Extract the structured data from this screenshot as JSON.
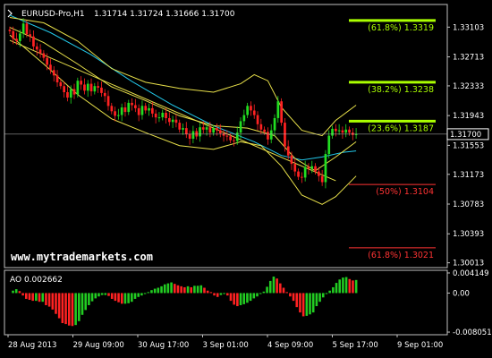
{
  "chart_data": [
    {
      "type": "candlestick",
      "title": "EURUSD-Pro,H1",
      "ohlc_header": "1.31714 1.31724 1.31666 1.31700",
      "current_price": 1.317,
      "ylim": [
        1.2995,
        1.334
      ],
      "y_ticks": [
        "1.33103",
        "1.32713",
        "1.32333",
        "1.31943",
        "1.31553",
        "1.31173",
        "1.30783",
        "1.30393",
        "1.30013"
      ],
      "y_tick_values": [
        1.33103,
        1.32713,
        1.32333,
        1.31943,
        1.31553,
        1.31173,
        1.30783,
        1.30393,
        1.30013
      ],
      "price_label": "1.31700",
      "x_tick_labels": [
        "28 Aug 2013",
        "29 Aug 09:00",
        "30 Aug 17:00",
        "3 Sep 01:00",
        "4 Sep 09:00",
        "5 Sep 17:00",
        "9 Sep 01:00"
      ],
      "close_path": [
        1.3305,
        1.3295,
        1.3292,
        1.3302,
        1.3315,
        1.3301,
        1.3298,
        1.3285,
        1.3281,
        1.3276,
        1.327,
        1.3261,
        1.3254,
        1.3247,
        1.3238,
        1.3233,
        1.3225,
        1.3218,
        1.3229,
        1.3222,
        1.324,
        1.3235,
        1.3227,
        1.3236,
        1.3226,
        1.3233,
        1.3231,
        1.3224,
        1.322,
        1.3207,
        1.32,
        1.3194,
        1.3195,
        1.3205,
        1.3199,
        1.3211,
        1.3208,
        1.3204,
        1.3195,
        1.3207,
        1.3201,
        1.3204,
        1.3197,
        1.3192,
        1.3192,
        1.3198,
        1.3191,
        1.3186,
        1.3189,
        1.3185,
        1.3176,
        1.3178,
        1.317,
        1.3164,
        1.3174,
        1.3167,
        1.3179,
        1.3176,
        1.3179,
        1.3172,
        1.3178,
        1.3175,
        1.3171,
        1.3168,
        1.3167,
        1.3162,
        1.3161,
        1.3172,
        1.3187,
        1.3195,
        1.3207,
        1.3201,
        1.3195,
        1.3183,
        1.3176,
        1.3173,
        1.3163,
        1.3175,
        1.3191,
        1.3213,
        1.3185,
        1.3154,
        1.3142,
        1.3131,
        1.3121,
        1.3114,
        1.3113,
        1.3127,
        1.3125,
        1.3128,
        1.3121,
        1.3115,
        1.3107,
        1.3144,
        1.3168,
        1.3177,
        1.3174,
        1.3175,
        1.3172,
        1.3176,
        1.3172,
        1.3169,
        1.317
      ],
      "indicators": {
        "bollinger_upper": [
          [
            0,
            1.3323
          ],
          [
            10,
            1.3316
          ],
          [
            20,
            1.3292
          ],
          [
            30,
            1.3256
          ],
          [
            40,
            1.3238
          ],
          [
            50,
            1.323
          ],
          [
            60,
            1.3225
          ],
          [
            68,
            1.3236
          ],
          [
            72,
            1.3248
          ],
          [
            76,
            1.324
          ],
          [
            80,
            1.3205
          ],
          [
            86,
            1.3175
          ],
          [
            92,
            1.3168
          ],
          [
            96,
            1.3188
          ],
          [
            102,
            1.3208
          ]
        ],
        "bollinger_lower": [
          [
            0,
            1.33
          ],
          [
            10,
            1.3262
          ],
          [
            20,
            1.3222
          ],
          [
            30,
            1.319
          ],
          [
            40,
            1.3172
          ],
          [
            50,
            1.3155
          ],
          [
            60,
            1.315
          ],
          [
            68,
            1.316
          ],
          [
            74,
            1.3155
          ],
          [
            80,
            1.3128
          ],
          [
            86,
            1.309
          ],
          [
            92,
            1.3078
          ],
          [
            96,
            1.3088
          ],
          [
            102,
            1.3115
          ]
        ],
        "bollinger_middle": [
          [
            0,
            1.331
          ],
          [
            10,
            1.329
          ],
          [
            20,
            1.3262
          ],
          [
            30,
            1.3232
          ],
          [
            40,
            1.3214
          ],
          [
            50,
            1.3194
          ],
          [
            60,
            1.3181
          ],
          [
            70,
            1.3178
          ],
          [
            78,
            1.3168
          ],
          [
            84,
            1.3138
          ],
          [
            90,
            1.3122
          ],
          [
            96,
            1.314
          ],
          [
            102,
            1.316
          ]
        ],
        "moving_average": [
          [
            0,
            1.3326
          ],
          [
            12,
            1.3303
          ],
          [
            24,
            1.3274
          ],
          [
            36,
            1.3239
          ],
          [
            48,
            1.3208
          ],
          [
            60,
            1.3181
          ],
          [
            72,
            1.316
          ],
          [
            80,
            1.3142
          ],
          [
            86,
            1.3136
          ],
          [
            92,
            1.314
          ],
          [
            98,
            1.3146
          ],
          [
            102,
            1.3148
          ]
        ],
        "trendline": [
          [
            0,
            1.3293
          ],
          [
            96,
            1.3109
          ]
        ]
      },
      "fibonacci": [
        {
          "label": "(61.8%) 1.3319",
          "value": 1.3319,
          "color": "#aaff00"
        },
        {
          "label": "(38.2%) 1.3238",
          "value": 1.3238,
          "color": "#aaff00"
        },
        {
          "label": "(23.6%) 1.3187",
          "value": 1.3187,
          "color": "#aaff00"
        },
        {
          "label": "(50%) 1.3104",
          "value": 1.3104,
          "color": "#ff3333"
        },
        {
          "label": "(61.8%) 1.3021",
          "value": 1.3021,
          "color": "#ff3333"
        }
      ],
      "watermark": "www.mytrademarkets.com"
    },
    {
      "type": "histogram",
      "title": "AO 0.002662",
      "ylim": [
        -0.0086,
        0.0047
      ],
      "y_ticks": [
        "0.004149",
        "0.00",
        "-0.008051"
      ],
      "values": [
        0.0,
        0.0005,
        0.0008,
        0.0004,
        -0.0005,
        -0.0012,
        -0.0014,
        -0.0016,
        -0.0016,
        -0.0018,
        -0.0018,
        -0.0025,
        -0.0028,
        -0.0034,
        -0.0043,
        -0.0052,
        -0.0062,
        -0.0064,
        -0.0067,
        -0.0068,
        -0.0066,
        -0.0058,
        -0.0045,
        -0.0035,
        -0.0025,
        -0.0017,
        -0.0011,
        -0.0007,
        -0.0004,
        -0.0004,
        -0.0006,
        -0.0012,
        -0.0016,
        -0.0019,
        -0.0022,
        -0.0022,
        -0.0021,
        -0.0018,
        -0.0012,
        -0.0008,
        -0.0005,
        -0.0002,
        0.0002,
        0.0006,
        0.0009,
        0.0011,
        0.0014,
        0.0018,
        0.002,
        0.0022,
        0.0019,
        0.0016,
        0.0014,
        0.0012,
        0.0014,
        0.0012,
        0.0015,
        0.0015,
        0.0016,
        0.0011,
        0.0005,
        0.0002,
        -0.0005,
        -0.0008,
        -0.0004,
        -0.0002,
        -0.0005,
        -0.0016,
        -0.0024,
        -0.0027,
        -0.0025,
        -0.0023,
        -0.002,
        -0.0016,
        -0.0011,
        -0.0007,
        -0.0002,
        0.0003,
        0.0013,
        0.0025,
        0.0034,
        0.003,
        0.002,
        0.0011,
        0.0002,
        -0.0007,
        -0.0016,
        -0.0029,
        -0.004,
        -0.0048,
        -0.0047,
        -0.0044,
        -0.004,
        -0.0027,
        -0.0018,
        -0.0009,
        -0.0002,
        0.0005,
        0.0012,
        0.0021,
        0.0028,
        0.0032,
        0.0033,
        0.0029,
        0.0026,
        0.0027
      ]
    }
  ]
}
